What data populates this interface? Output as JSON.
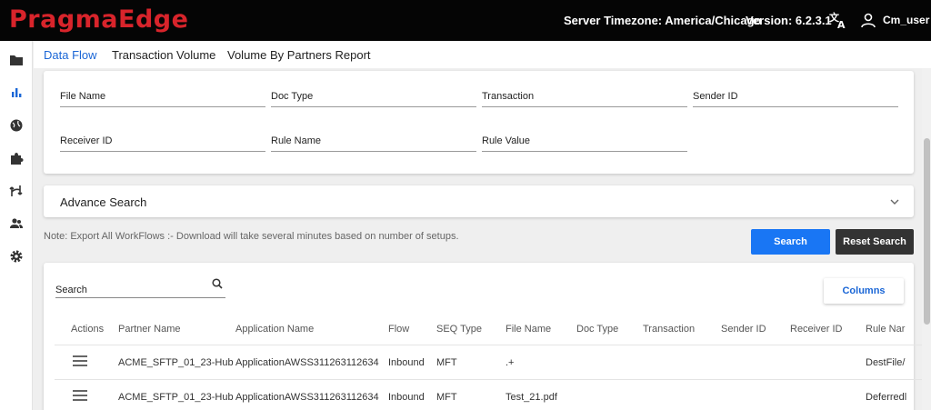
{
  "header": {
    "logo": "PragmaEdge",
    "timezone": "Server Timezone: America/Chicago",
    "version": "Version: 6.2.3.1",
    "user": "Cm_user"
  },
  "sidebar": {
    "icons": [
      "folder-icon",
      "bar-chart-icon",
      "globe-icon",
      "puzzle-icon",
      "route-icon",
      "people-icon",
      "gear-icon"
    ]
  },
  "tabs": [
    "Data Flow",
    "Transaction Volume",
    "Volume By Partners Report"
  ],
  "filters": {
    "file_name": "File Name",
    "doc_type": "Doc Type",
    "transaction": "Transaction",
    "sender_id": "Sender ID",
    "receiver_id": "Receiver ID",
    "rule_name": "Rule Name",
    "rule_value": "Rule Value"
  },
  "advance_search": "Advance Search",
  "note": "Note: Export All WorkFlows :- Download will take several minutes based on number of setups.",
  "buttons": {
    "search": "Search",
    "reset": "Reset Search",
    "columns": "Columns"
  },
  "table_search_placeholder": "Search",
  "table": {
    "columns": [
      "Actions",
      "Partner Name",
      "Application Name",
      "Flow",
      "SEQ Type",
      "File Name",
      "Doc Type",
      "Transaction",
      "Sender ID",
      "Receiver ID",
      "Rule Nar"
    ],
    "rows": [
      {
        "partner": "ACME_SFTP_01_23-Hub",
        "application": "ApplicationAWSS311263112634",
        "flow": "Inbound",
        "seq_type": "MFT",
        "file_name": ".+",
        "doc_type": "",
        "transaction": "",
        "sender_id": "",
        "receiver_id": "",
        "rule_name": "DestFile/"
      },
      {
        "partner": "ACME_SFTP_01_23-Hub",
        "application": "ApplicationAWSS311263112634",
        "flow": "Inbound",
        "seq_type": "MFT",
        "file_name": "Test_21.pdf",
        "doc_type": "",
        "transaction": "",
        "sender_id": "",
        "receiver_id": "",
        "rule_name": "Deferredl"
      }
    ]
  },
  "colors": {
    "brand_red": "#d8242b",
    "accent_blue": "#1976f4",
    "topbar": "#050505"
  }
}
